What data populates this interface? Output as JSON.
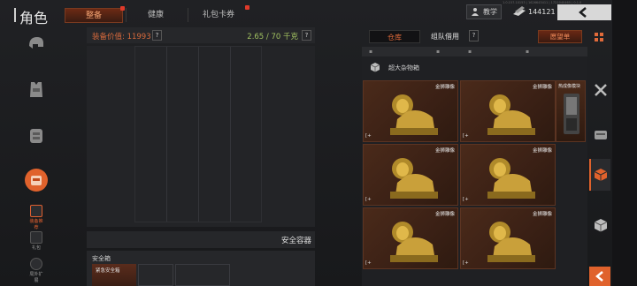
{
  "header": {
    "title": "角色",
    "tabs": [
      {
        "label": "整备",
        "active": true,
        "dot": true
      },
      {
        "label": "健康",
        "active": false,
        "dot": false
      },
      {
        "label": "礼包卡券",
        "active": false,
        "dot": true
      }
    ],
    "build_text": "1.0.157.10153 | 1626643411 | 1721040465 | 0.1.0",
    "teach_label": "教学",
    "currency_value": "144121"
  },
  "sidebar": {
    "small_items": [
      {
        "label": "装备推荐",
        "active": true
      },
      {
        "label": "礼包",
        "active": false
      },
      {
        "label": "局外扩展",
        "active": false
      }
    ]
  },
  "stash_panel": {
    "value_label": "装备价值:",
    "value": "11993",
    "help": "?",
    "weight": "2.65 / 70 千克",
    "weight_help": "?",
    "safe_container_label": "安全容器",
    "safebox_label": "安全箱",
    "safebox_item": "紧急安全箱"
  },
  "warehouse": {
    "tab_active": "仓库",
    "tab_team": "组队借用",
    "help": "?",
    "wishlist": "愿望单",
    "box_label": "超大杂物箱",
    "items": [
      {
        "name": "金狮雕像",
        "corner": "[+"
      },
      {
        "name": "金狮雕像",
        "corner": "[+"
      },
      {
        "name": "金狮雕像",
        "corner": "[+"
      },
      {
        "name": "金狮雕像",
        "corner": "[+"
      },
      {
        "name": "金狮雕像",
        "corner": "[+"
      },
      {
        "name": "金狮雕像",
        "corner": "[+"
      }
    ],
    "side_item": "热成像模块"
  },
  "colors": {
    "accent": "#e0622c",
    "value_text": "#d86a3c",
    "weight_text": "#a0c060"
  }
}
